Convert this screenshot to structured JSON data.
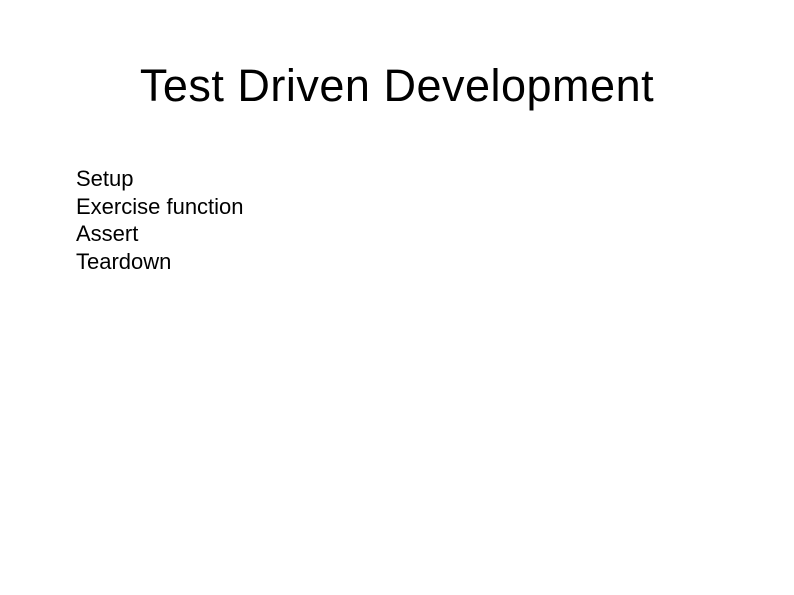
{
  "title": "Test Driven Development",
  "items": [
    "Setup",
    "Exercise function",
    "Assert",
    "Teardown"
  ]
}
